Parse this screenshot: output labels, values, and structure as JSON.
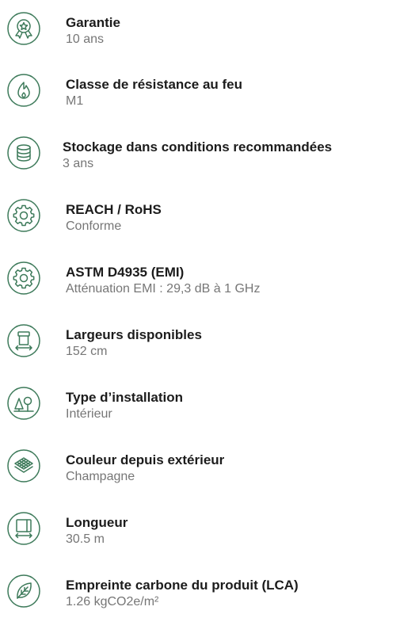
{
  "accent_color": "#3d7a5a",
  "specs": [
    {
      "label": "Garantie",
      "value": "10 ans",
      "icon": "warranty-badge-icon"
    },
    {
      "label": "Classe de résistance au feu",
      "value": "M1",
      "icon": "flame-icon"
    },
    {
      "label": "Stockage dans conditions recommandées",
      "value": "3 ans",
      "icon": "database-icon"
    },
    {
      "label": "REACH / RoHS",
      "value": "Conforme",
      "icon": "gear-icon"
    },
    {
      "label": "ASTM D4935 (EMI)",
      "value": "Atténuation EMI : 29,3 dB à 1 GHz",
      "icon": "gear-icon"
    },
    {
      "label": "Largeurs disponibles",
      "value": "152 cm",
      "icon": "roll-width-icon"
    },
    {
      "label": "Type d’installation",
      "value": "Intérieur",
      "icon": "tree-house-icon"
    },
    {
      "label": "Couleur depuis extérieur",
      "value": "Champagne",
      "icon": "layers-icon"
    },
    {
      "label": "Longueur",
      "value": "30.5 m",
      "icon": "length-icon"
    },
    {
      "label": "Empreinte carbone du produit (LCA)",
      "value": "1.26 kgCO2e/m²",
      "icon": "leaf-icon"
    }
  ]
}
